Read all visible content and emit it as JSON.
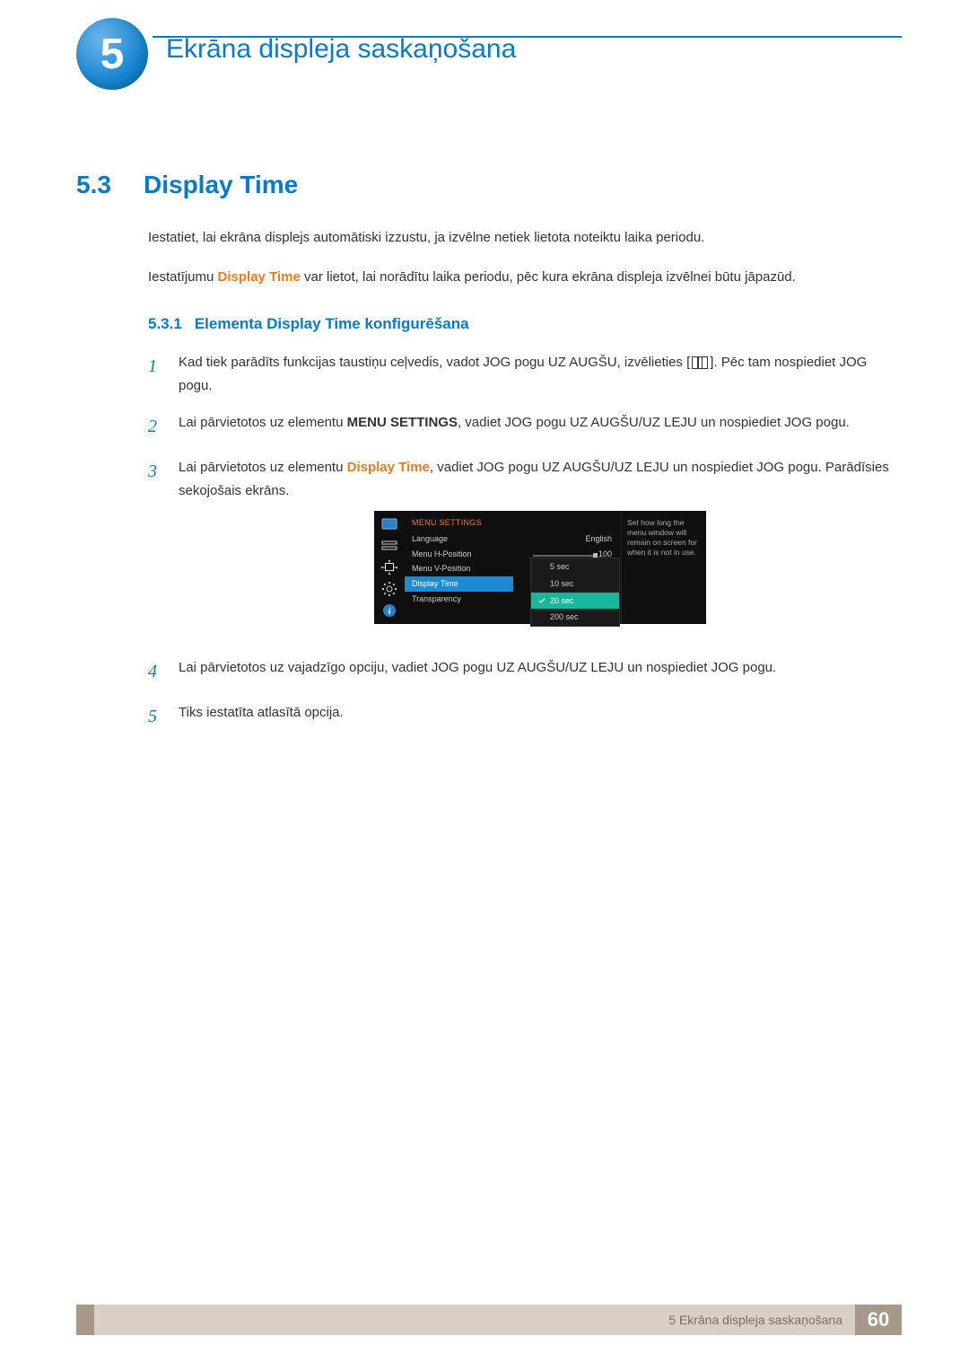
{
  "chapter": {
    "number": "5",
    "title": "Ekrāna displeja saskaņošana"
  },
  "section": {
    "number": "5.3",
    "title": "Display Time"
  },
  "intro": {
    "p1": "Iestatiet, lai ekrāna displejs automātiski izzustu, ja izvēlne netiek lietota noteiktu laika periodu.",
    "p2a": "Iestatījumu ",
    "p2_em": "Display Time",
    "p2b": " var lietot, lai norādītu laika periodu, pēc kura ekrāna displeja izvēlnei būtu jāpazūd."
  },
  "subsection": {
    "number": "5.3.1",
    "title": "Elementa Display Time konfigurēšana"
  },
  "steps": {
    "s1": {
      "n": "1",
      "a": "Kad tiek parādīts funkcijas taustiņu ceļvedis, vadot JOG pogu UZ AUGŠU, izvēlieties [",
      "b": "]. Pēc tam nospiediet JOG pogu."
    },
    "s2": {
      "n": "2",
      "a": "Lai pārvietotos uz elementu ",
      "em": "MENU SETTINGS",
      "b": ", vadiet JOG pogu UZ AUGŠU/UZ LEJU un nospiediet JOG pogu."
    },
    "s3": {
      "n": "3",
      "a": "Lai pārvietotos uz elementu ",
      "em": "Display Time",
      "b": ", vadiet JOG pogu UZ AUGŠU/UZ LEJU un nospiediet JOG pogu. Parādīsies sekojošais ekrāns."
    },
    "s4": {
      "n": "4",
      "t": "Lai pārvietotos uz vajadzīgo opciju, vadiet JOG pogu UZ AUGŠU/UZ LEJU un nospiediet JOG pogu."
    },
    "s5": {
      "n": "5",
      "t": "Tiks iestatīta atlasītā opcija."
    }
  },
  "osd": {
    "header": "MENU SETTINGS",
    "rows": {
      "language": {
        "label": "Language",
        "value": "English"
      },
      "hpos": {
        "label": "Menu H-Position",
        "value": "100"
      },
      "vpos": {
        "label": "Menu V-Position"
      },
      "display_time": {
        "label": "Display Time"
      },
      "transparency": {
        "label": "Transparency"
      }
    },
    "options": {
      "o1": "5 sec",
      "o2": "10 sec",
      "o3": "20 sec",
      "o4": "200 sec"
    },
    "help": "Set how long the menu window will remain on screen for when it is not in use."
  },
  "footer": {
    "label": "5 Ekrāna displeja saskaņošana",
    "page": "60"
  }
}
